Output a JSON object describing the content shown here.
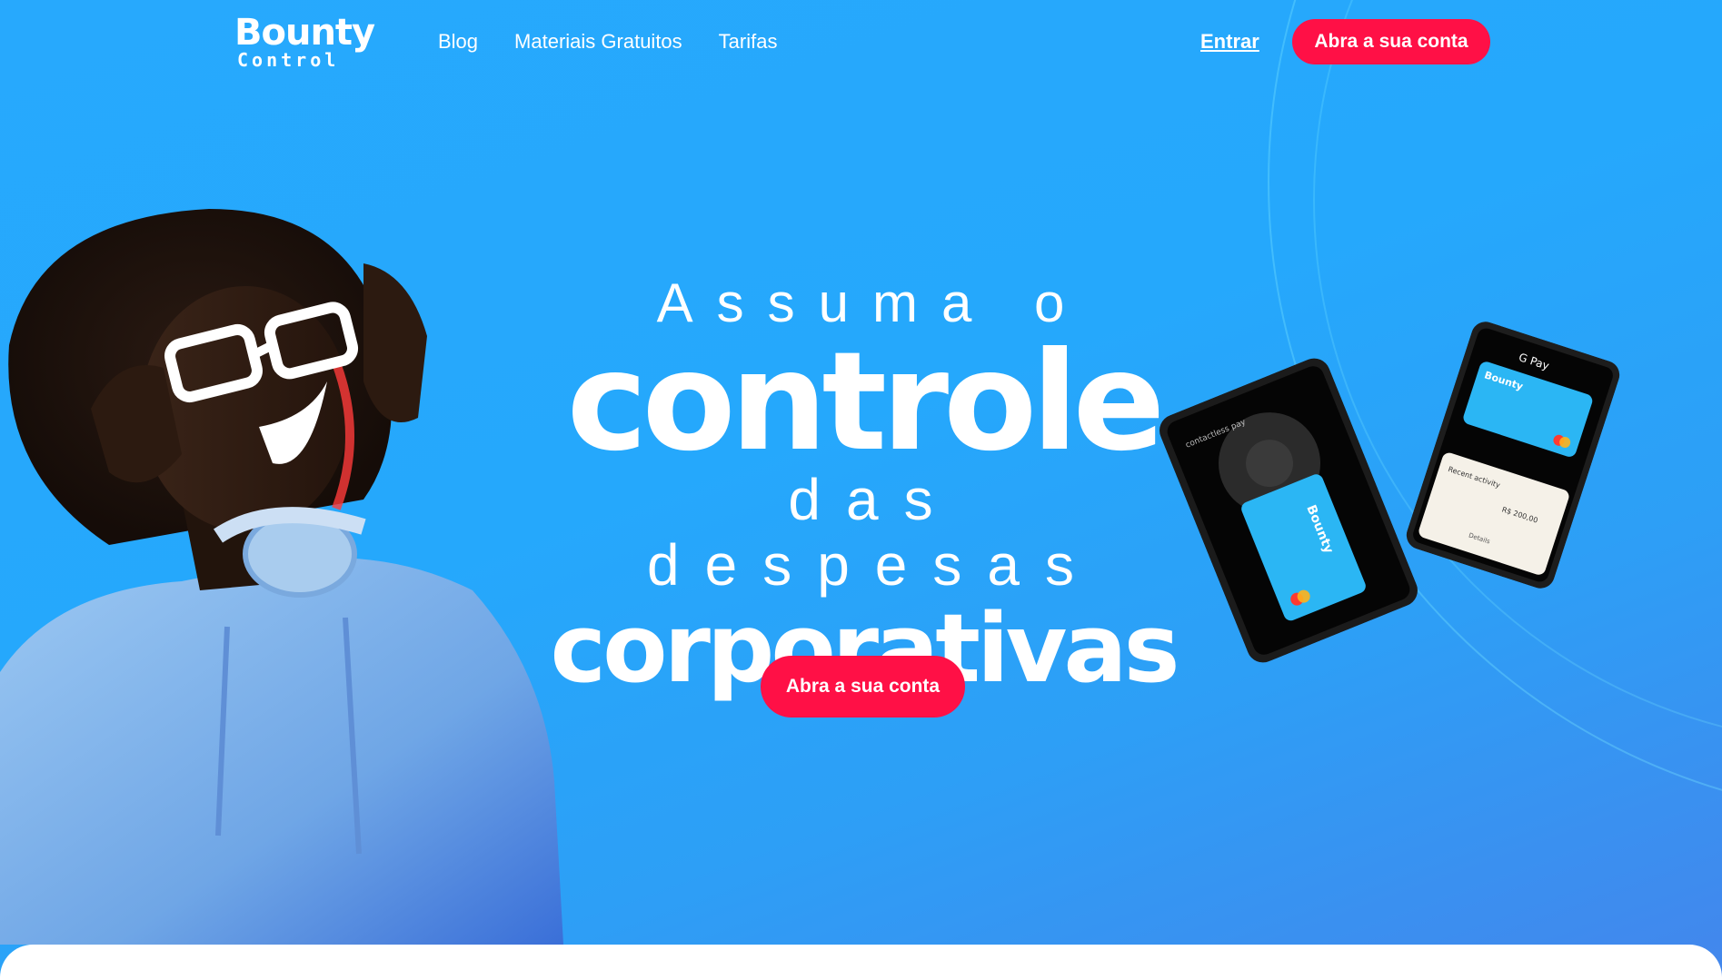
{
  "nav": {
    "logo_main": "Bounty",
    "logo_sub": "Control",
    "links": [
      "Blog",
      "Materiais Gratuitos",
      "Tarifas"
    ],
    "login": "Entrar",
    "cta": "Abra a sua conta"
  },
  "hero": {
    "line1": "Assuma o",
    "line2": "controle",
    "line3": "das despesas",
    "line4": "corporativas",
    "cta": "Abra a sua conta"
  },
  "phones": {
    "left_app": "Bounty",
    "left_header": "contactless pay",
    "right_app": "G Pay",
    "right_card": "Bounty",
    "right_activity": "Recent activity",
    "right_amount": "R$ 200,00",
    "right_button": "Details"
  },
  "colors": {
    "brand_blue": "#27a7fb",
    "accent_red": "#ff1046",
    "white": "#ffffff"
  }
}
